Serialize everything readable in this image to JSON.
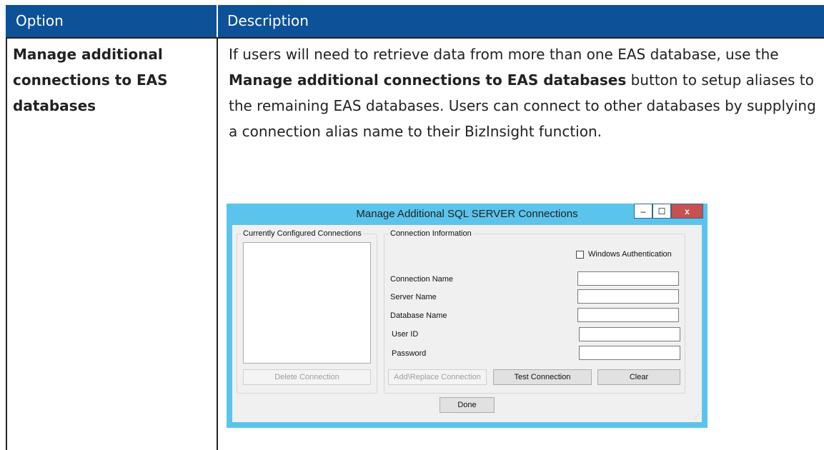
{
  "table": {
    "header": {
      "option": "Option",
      "description": "Description"
    },
    "row": {
      "option": "Manage additional connections to EAS databases",
      "desc_part1": "If users will need to retrieve data from more than one EAS database, use the ",
      "desc_bold": "Manage additional connections to EAS databases",
      "desc_part2": " button to setup aliases to the remaining EAS databases. Users can connect to other databases by supplying a connection alias name to their BizInsight function."
    }
  },
  "dialog": {
    "title": "Manage Additional SQL SERVER Connections",
    "window_buttons": {
      "minimize": "–",
      "maximize": "☐",
      "close": "x"
    },
    "left_group": {
      "label": "Currently Configured Connections",
      "delete_button": "Delete Connection"
    },
    "right_group": {
      "label": "Connection Information",
      "windows_auth_label": "Windows Authentication",
      "windows_auth_checked": false,
      "fields": {
        "connection_name": {
          "label": "Connection Name",
          "value": ""
        },
        "server_name": {
          "label": "Server Name",
          "value": ""
        },
        "database_name": {
          "label": "Database Name",
          "value": ""
        },
        "user_id": {
          "label": "User ID",
          "value": ""
        },
        "password": {
          "label": "Password",
          "value": ""
        }
      },
      "add_replace_button": "Add\\Replace Connection",
      "test_button": "Test Connection",
      "clear_button": "Clear"
    },
    "done_button": "Done"
  }
}
